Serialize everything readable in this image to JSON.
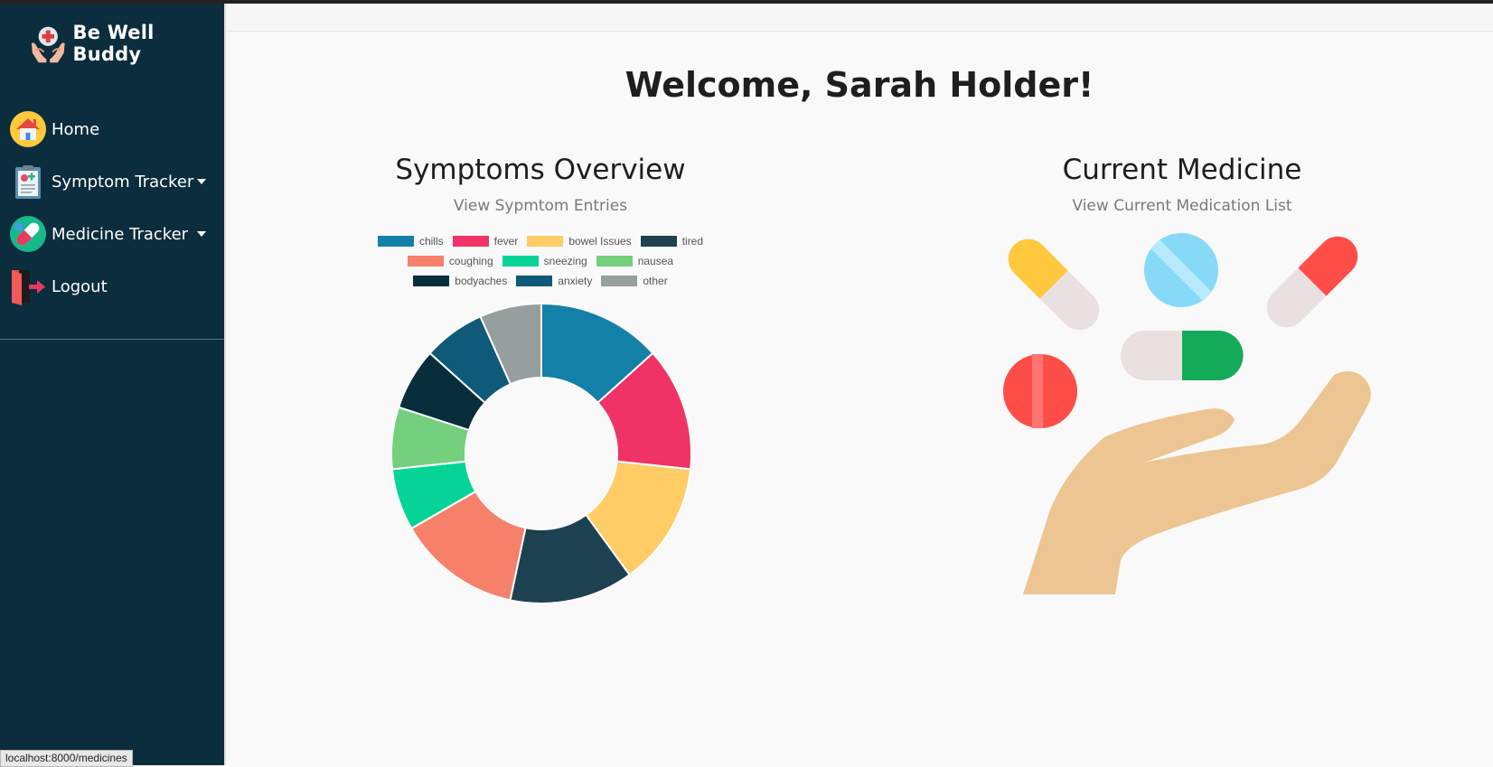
{
  "app": {
    "name": "Be Well Buddy"
  },
  "sidebar": {
    "items": [
      {
        "label": "Home",
        "icon": "home-icon",
        "dropdown": false
      },
      {
        "label": "Symptom Tracker",
        "icon": "clipboard-icon",
        "dropdown": true
      },
      {
        "label": "Medicine Tracker",
        "icon": "pills-icon",
        "dropdown": true
      },
      {
        "label": "Logout",
        "icon": "logout-door-icon",
        "dropdown": false
      }
    ]
  },
  "main": {
    "welcome": "Welcome, Sarah Holder!",
    "symptoms": {
      "title": "Symptoms Overview",
      "link": "View Sypmtom Entries"
    },
    "medicine": {
      "title": "Current Medicine",
      "link": "View Current Medication List"
    }
  },
  "status_bar": {
    "url": "localhost:8000/medicines"
  },
  "colors": {
    "sidebar_bg": "#0b2d3d",
    "page_bg": "#f9f9f9"
  },
  "chart_data": {
    "type": "pie",
    "variant": "doughnut",
    "legend_position": "top",
    "categories": [
      "chills",
      "fever",
      "bowel Issues",
      "tired",
      "coughing",
      "sneezing",
      "nausea",
      "bodyaches",
      "anxiety",
      "other"
    ],
    "values": [
      2,
      2,
      2,
      2,
      2,
      1,
      1,
      1,
      1,
      1
    ],
    "colors": [
      "#1380a8",
      "#ef3366",
      "#ffcc66",
      "#1d4150",
      "#f7806a",
      "#06d496",
      "#74d07c",
      "#082d3b",
      "#0e5a78",
      "#979e9e"
    ]
  }
}
